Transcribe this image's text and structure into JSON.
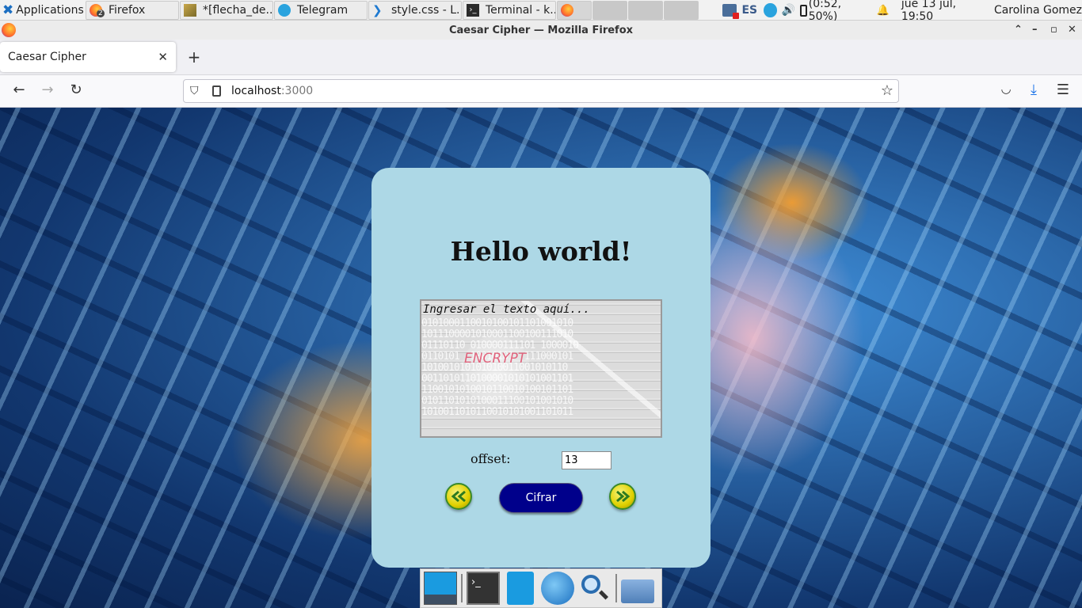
{
  "taskbar": {
    "applications_label": "Applications",
    "tasks": [
      {
        "label": "Firefox",
        "badge": "2"
      },
      {
        "label": "*[flecha_de..."
      },
      {
        "label": "Telegram"
      },
      {
        "label": "style.css - L..."
      },
      {
        "label": "Terminal - k..."
      }
    ],
    "keyboard_layout": "ES",
    "battery": "(0:52, 50%)",
    "datetime": "jue 13 jul, 19:50",
    "user": "Carolina Gomez"
  },
  "window": {
    "title": "Caesar Cipher — Mozilla Firefox"
  },
  "browser": {
    "tab_title": "Caesar Cipher",
    "url_host": "localhost",
    "url_port": ":3000"
  },
  "page": {
    "heading": "Hello world!",
    "text_placeholder": "Ingresar el texto aquí...",
    "offset_label": "offset:",
    "offset_value": "13",
    "submit_label": "Cifrar",
    "image_word": "ENCRYPT"
  },
  "colors": {
    "card_bg": "#add8e6",
    "button_bg": "#00008b",
    "arrow_fill": "#e0d000"
  }
}
